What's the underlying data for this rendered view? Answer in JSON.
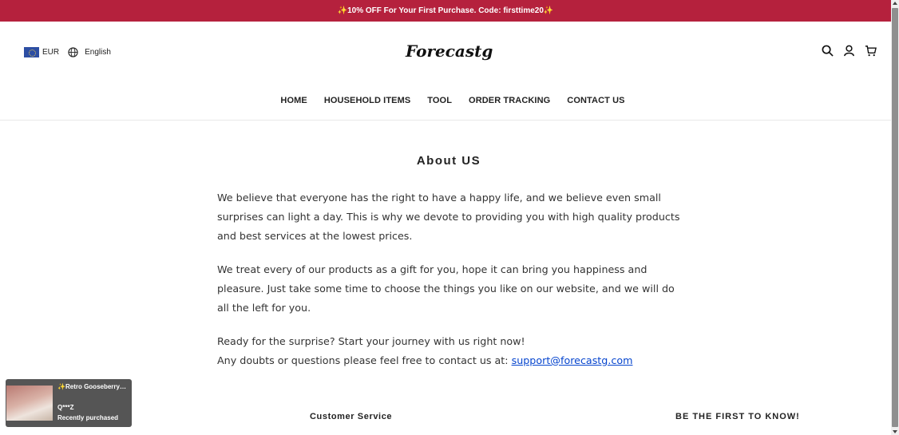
{
  "announcement": "✨10% OFF For Your First Purchase. Code: firsttime20✨",
  "header": {
    "currency": "EUR",
    "language": "English",
    "logo": "Forecastg",
    "icons": [
      "search-icon",
      "user-icon",
      "cart-icon"
    ]
  },
  "nav": [
    "HOME",
    "HOUSEHOLD ITEMS",
    "TOOL",
    "ORDER TRACKING",
    "CONTACT US"
  ],
  "page": {
    "title": "About US",
    "p1": "We believe that everyone has the right to have a happy life, and we believe even small surprises can light a day. This is why we devote to providing you with high quality products and best services at the lowest prices.",
    "p2": "We treat every of our products as a gift for you, hope it can bring you happiness and pleasure. Just take some time to choose the things you like on our website, and we will do all the left for you.",
    "p3": "Ready for the surprise? Start your journey with us right now!",
    "p4_prefix": "Any doubts or questions please feel free to contact us at: ",
    "email": "support@forecastg.com"
  },
  "popup": {
    "product": "✨Retro Gooseberry…",
    "buyer": "Q***Z",
    "status": "Recently purchased"
  },
  "footer": {
    "customer_service": "Customer Service",
    "be_first": "BE THE FIRST TO KNOW!"
  },
  "colors": {
    "announcement_bg": "#b5213d",
    "link": "#0645ce"
  }
}
